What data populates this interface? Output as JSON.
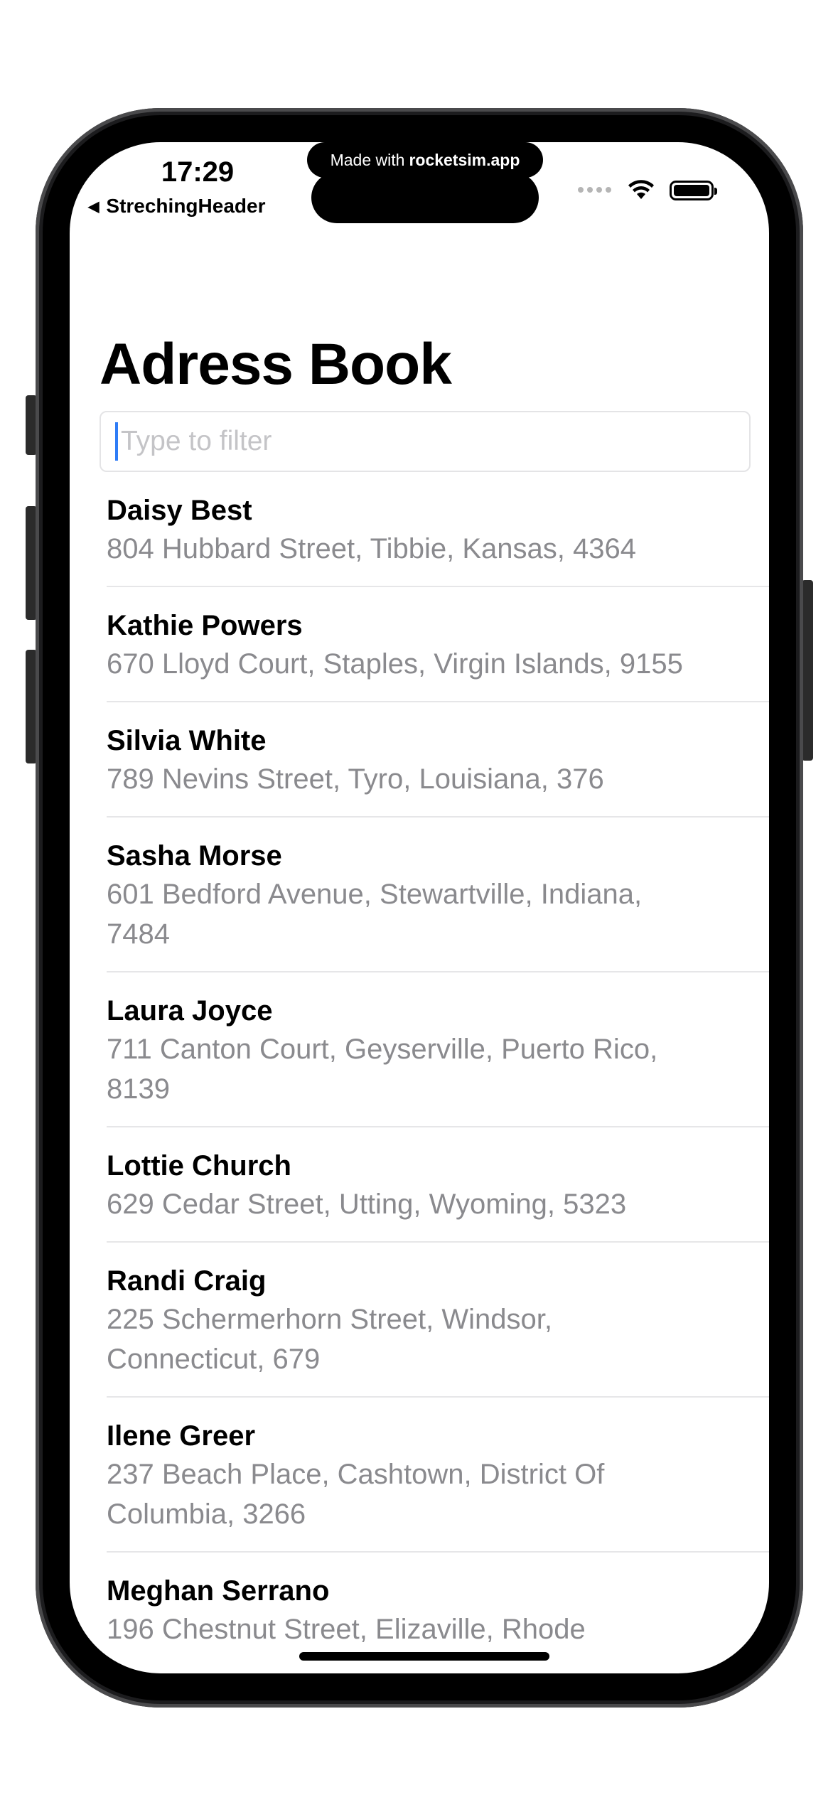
{
  "watermark": {
    "prefix": "Made with",
    "brand": "rocketsim.app"
  },
  "status_bar": {
    "time": "17:29",
    "back_label": "StrechingHeader"
  },
  "page": {
    "title": "Adress Book"
  },
  "search": {
    "placeholder": "Type to filter",
    "value": ""
  },
  "contacts": [
    {
      "name": "Daisy Best",
      "address": "804 Hubbard Street, Tibbie, Kansas, 4364"
    },
    {
      "name": "Kathie Powers",
      "address": "670 Lloyd Court, Staples, Virgin Islands, 9155"
    },
    {
      "name": "Silvia White",
      "address": "789 Nevins Street, Tyro, Louisiana, 376"
    },
    {
      "name": "Sasha Morse",
      "address": "601 Bedford Avenue, Stewartville, Indiana, 7484"
    },
    {
      "name": "Laura Joyce",
      "address": "711 Canton Court, Geyserville, Puerto Rico, 8139"
    },
    {
      "name": "Lottie Church",
      "address": "629 Cedar Street, Utting, Wyoming, 5323"
    },
    {
      "name": "Randi Craig",
      "address": "225 Schermerhorn Street, Windsor, Connecticut, 679"
    },
    {
      "name": "Ilene Greer",
      "address": "237 Beach Place, Cashtown, District Of Columbia, 3266"
    },
    {
      "name": "Meghan Serrano",
      "address": "196 Chestnut Street, Elizaville, Rhode"
    }
  ],
  "icons": {
    "wifi": "wifi-icon",
    "battery": "battery-icon",
    "signal": "signal-dots-icon",
    "back": "back-arrow-icon"
  }
}
